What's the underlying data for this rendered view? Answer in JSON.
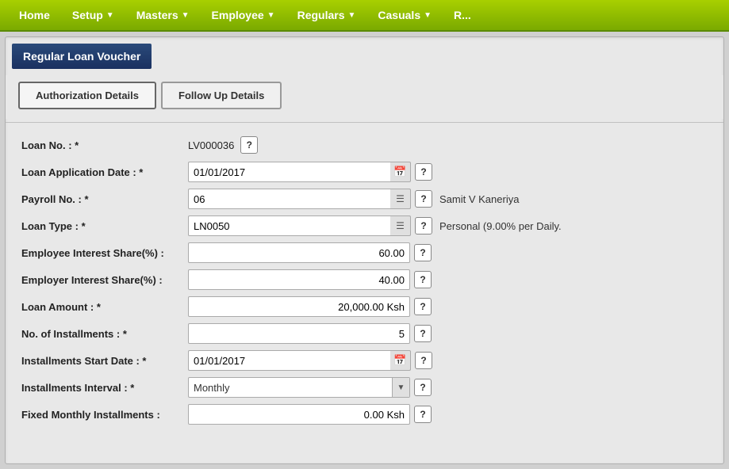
{
  "navbar": {
    "items": [
      {
        "label": "Home",
        "has_arrow": false
      },
      {
        "label": "Setup",
        "has_arrow": true
      },
      {
        "label": "Masters",
        "has_arrow": true
      },
      {
        "label": "Employee",
        "has_arrow": true
      },
      {
        "label": "Regulars",
        "has_arrow": true
      },
      {
        "label": "Casuals",
        "has_arrow": true
      },
      {
        "label": "R...",
        "has_arrow": false
      }
    ]
  },
  "page": {
    "title": "Regular Loan Voucher"
  },
  "tabs": [
    {
      "label": "Authorization Details",
      "active": true
    },
    {
      "label": "Follow Up Details",
      "active": false
    }
  ],
  "form": {
    "fields": [
      {
        "label": "Loan No. : *",
        "type": "loanno",
        "value": "LV000036"
      },
      {
        "label": "Loan Application Date : *",
        "type": "date",
        "value": "01/01/2017"
      },
      {
        "label": "Payroll No. : *",
        "type": "list",
        "value": "06",
        "side_text": "Samit V Kaneriya"
      },
      {
        "label": "Loan Type : *",
        "type": "list",
        "value": "LN0050",
        "side_text": "Personal (9.00% per Daily."
      },
      {
        "label": "Employee Interest Share(%) :",
        "type": "number",
        "value": "60.00"
      },
      {
        "label": "Employer Interest Share(%) :",
        "type": "number",
        "value": "40.00"
      },
      {
        "label": "Loan Amount : *",
        "type": "number",
        "value": "20,000.00 Ksh"
      },
      {
        "label": "No. of Installments : *",
        "type": "number",
        "value": "5"
      },
      {
        "label": "Installments Start Date : *",
        "type": "date",
        "value": "01/01/2017"
      },
      {
        "label": "Installments Interval : *",
        "type": "dropdown",
        "value": "Monthly"
      },
      {
        "label": "Fixed Monthly Installments :",
        "type": "number",
        "value": "0.00 Ksh"
      }
    ]
  },
  "icons": {
    "calendar": "📅",
    "list": "☰",
    "dropdown_arrow": "▼",
    "help": "?"
  }
}
